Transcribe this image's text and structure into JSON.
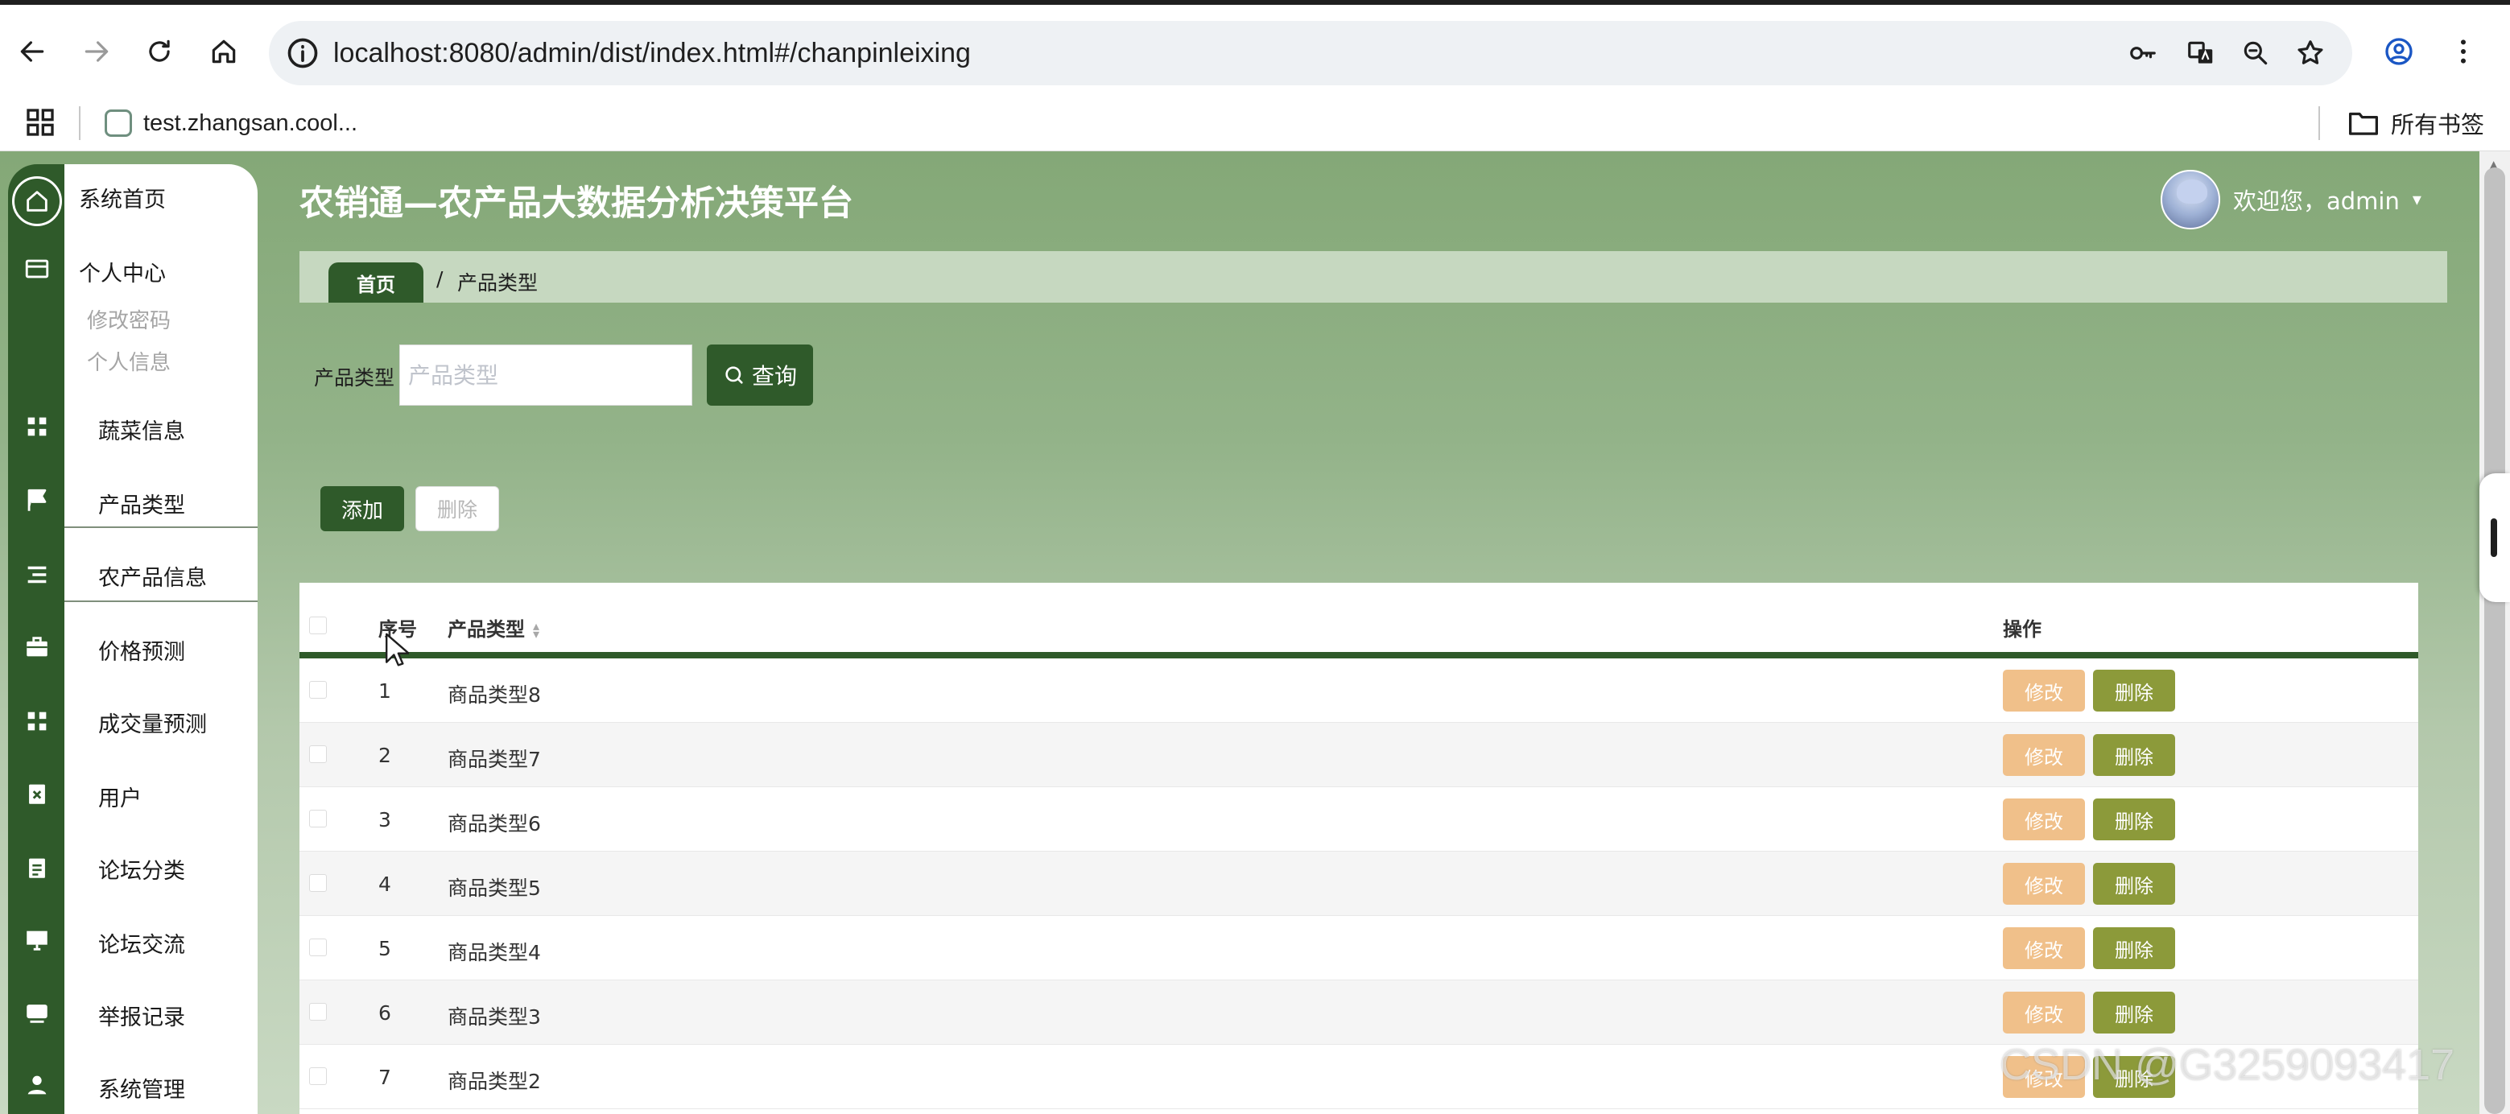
{
  "browser": {
    "url": "localhost:8080/admin/dist/index.html#/chanpinleixing",
    "bookmark": "test.zhangsan.cool...",
    "all_bookmarks": "所有书签"
  },
  "app": {
    "title": "农销通—农产品大数据分析决策平台",
    "welcome": "欢迎您，admin",
    "caret": "▾"
  },
  "sidebar": {
    "items": [
      {
        "label": "系统首页",
        "icon": "home-icon"
      },
      {
        "label": "个人中心",
        "icon": "id-card-icon",
        "subitems": [
          "修改密码",
          "个人信息"
        ]
      },
      {
        "label": "蔬菜信息",
        "icon": "grid-icon"
      },
      {
        "label": "产品类型",
        "icon": "flag-icon"
      },
      {
        "label": "农产品信息",
        "icon": "list-icon"
      },
      {
        "label": "价格预测",
        "icon": "briefcase-icon"
      },
      {
        "label": "成交量预测",
        "icon": "grid-icon"
      },
      {
        "label": "用户",
        "icon": "clipboard-x-icon"
      },
      {
        "label": "论坛分类",
        "icon": "clipboard-icon"
      },
      {
        "label": "论坛交流",
        "icon": "monitor-icon"
      },
      {
        "label": "举报记录",
        "icon": "tray-icon"
      },
      {
        "label": "系统管理",
        "icon": "person-icon"
      }
    ]
  },
  "breadcrumb": {
    "home": "首页",
    "separator": "/",
    "current": "产品类型"
  },
  "search": {
    "label": "产品类型",
    "placeholder": "产品类型",
    "button": "查询"
  },
  "actions": {
    "add": "添加",
    "delete": "删除"
  },
  "table": {
    "columns": [
      "序号",
      "产品类型",
      "操作"
    ],
    "edit_label": "修改",
    "delete_label": "删除",
    "rows": [
      {
        "index": "1",
        "type": "商品类型8"
      },
      {
        "index": "2",
        "type": "商品类型7"
      },
      {
        "index": "3",
        "type": "商品类型6"
      },
      {
        "index": "4",
        "type": "商品类型5"
      },
      {
        "index": "5",
        "type": "商品类型4"
      },
      {
        "index": "6",
        "type": "商品类型3"
      },
      {
        "index": "7",
        "type": "商品类型2"
      }
    ]
  },
  "watermark": "CSDN @G3259093417",
  "colors": {
    "primary": "#2f5a2a",
    "header_bg": "#84a877",
    "breadcrumb_bg": "#c6d8c0",
    "edit_button": "#f0c08a",
    "delete_button": "#8c9a3a"
  }
}
